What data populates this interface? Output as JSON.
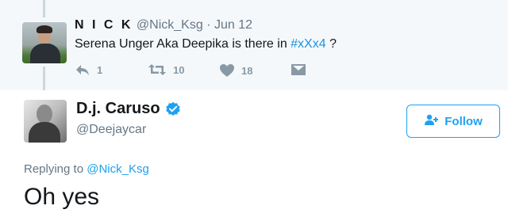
{
  "parent_tweet": {
    "name": "N I C K",
    "handle": "@Nick_Ksg",
    "separator": "·",
    "date": "Jun 12",
    "text_before": "Serena Unger Aka Deepika is there in ",
    "hashtag": "#xXx4",
    "text_after": "  ?",
    "actions": {
      "reply_count": "1",
      "retweet_count": "10",
      "like_count": "18"
    }
  },
  "main_tweet": {
    "name": "D.j. Caruso",
    "handle": "@Deejaycar",
    "verified": true,
    "follow_label": "Follow",
    "replying_prefix": "Replying to ",
    "replying_mention": "@Nick_Ksg",
    "text": "Oh yes"
  },
  "colors": {
    "accent": "#1da1f2",
    "muted": "#657786",
    "action_icon": "#8899a6",
    "thread_line": "#ccd6dd"
  },
  "icons": [
    "reply-icon",
    "retweet-icon",
    "like-icon",
    "direct-message-icon",
    "verified-badge-icon",
    "follow-person-icon"
  ]
}
